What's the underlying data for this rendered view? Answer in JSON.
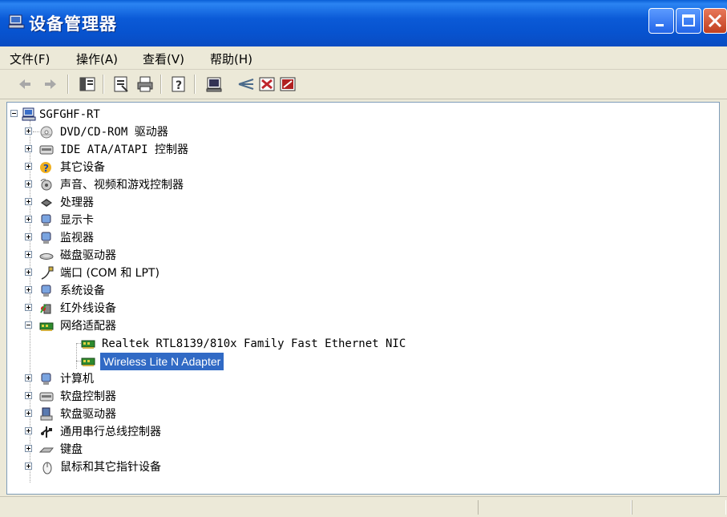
{
  "window": {
    "title": "设备管理器"
  },
  "menu": [
    "文件(F)",
    "操作(A)",
    "查看(V)",
    "帮助(H)"
  ],
  "toolbar": [
    "back-icon",
    "forward-icon",
    "show-hide-icon",
    "properties-icon",
    "print-icon",
    "help-icon",
    "update-driver-icon",
    "uninstall-icon",
    "disable-icon",
    "scan-hardware-icon"
  ],
  "tree": {
    "root": "SGFGHF-RT",
    "categories": [
      {
        "label": "DVD/CD-ROM 驱动器",
        "icon": "cdrom-icon"
      },
      {
        "label": "IDE ATA/ATAPI 控制器",
        "icon": "ide-controller-icon"
      },
      {
        "label": "其它设备",
        "icon": "unknown-device-icon"
      },
      {
        "label": "声音、视频和游戏控制器",
        "icon": "sound-icon"
      },
      {
        "label": "处理器",
        "icon": "processor-icon"
      },
      {
        "label": "显示卡",
        "icon": "display-adapter-icon"
      },
      {
        "label": "监视器",
        "icon": "monitor-icon"
      },
      {
        "label": "磁盘驱动器",
        "icon": "disk-drive-icon"
      },
      {
        "label": "端口 (COM 和 LPT)",
        "icon": "port-icon"
      },
      {
        "label": "系统设备",
        "icon": "system-device-icon"
      },
      {
        "label": "红外线设备",
        "icon": "infrared-icon"
      },
      {
        "label": "网络适配器",
        "icon": "network-adapter-icon",
        "expanded": true,
        "children": [
          {
            "label": "Realtek RTL8139/810x Family Fast Ethernet NIC",
            "icon": "network-card-icon"
          },
          {
            "label": "Wireless Lite N Adapter",
            "icon": "network-card-icon",
            "selected": true
          }
        ]
      },
      {
        "label": "计算机",
        "icon": "computer-icon"
      },
      {
        "label": "软盘控制器",
        "icon": "floppy-controller-icon"
      },
      {
        "label": "软盘驱动器",
        "icon": "floppy-drive-icon"
      },
      {
        "label": "通用串行总线控制器",
        "icon": "usb-icon"
      },
      {
        "label": "键盘",
        "icon": "keyboard-icon"
      },
      {
        "label": "鼠标和其它指针设备",
        "icon": "mouse-icon"
      }
    ]
  },
  "colors": {
    "title_bar": "#0a5fd6",
    "selection": "#316ac5",
    "tree_border": "#7f9db9"
  }
}
